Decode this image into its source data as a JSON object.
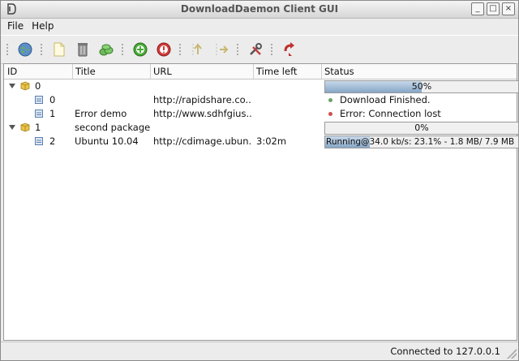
{
  "window": {
    "title": "DownloadDaemon Client GUI",
    "controls": [
      "_",
      "□",
      "×"
    ]
  },
  "menu": {
    "file": "File",
    "help": "Help"
  },
  "toolbar": [
    "connect-icon",
    "add-icon",
    "delete-icon",
    "delete-finished-icon",
    "activate-icon",
    "deactivate-icon",
    "priority-up-icon",
    "priority-down-icon",
    "configure-icon",
    "reload-icon"
  ],
  "table": {
    "columns": {
      "id": "ID",
      "title": "Title",
      "url": "URL",
      "time_left": "Time left",
      "status": "Status"
    },
    "packages": [
      {
        "id": "0",
        "title": "",
        "progress_text": "50%",
        "progress": 0.5,
        "downloads": [
          {
            "id": "0",
            "title": "",
            "url": "http://rapidshare.co...",
            "time_left": "",
            "status": "Download Finished.",
            "status_color": "#6aa16a"
          },
          {
            "id": "1",
            "title": "Error demo",
            "url": "http://www.sdhfgius...",
            "time_left": "",
            "status": "Error: Connection lost",
            "status_color": "#d05050"
          }
        ]
      },
      {
        "id": "1",
        "title": "second package",
        "progress_text": "0%",
        "progress": 0.0,
        "downloads": [
          {
            "id": "2",
            "title": "Ubuntu 10.04",
            "url": "http://cdimage.ubun...",
            "time_left": "3:02m",
            "status": "Running@34.0 kb/s: 23.1% - 1.8 MB/ 7.9 MB",
            "progress": 0.231
          }
        ]
      }
    ]
  },
  "statusbar": {
    "text": "Connected to 127.0.0.1"
  },
  "colors": {
    "progress_fill": "#86a6c6",
    "package_icon": "#e8c44a",
    "file_icon": "#5a7fb0"
  }
}
